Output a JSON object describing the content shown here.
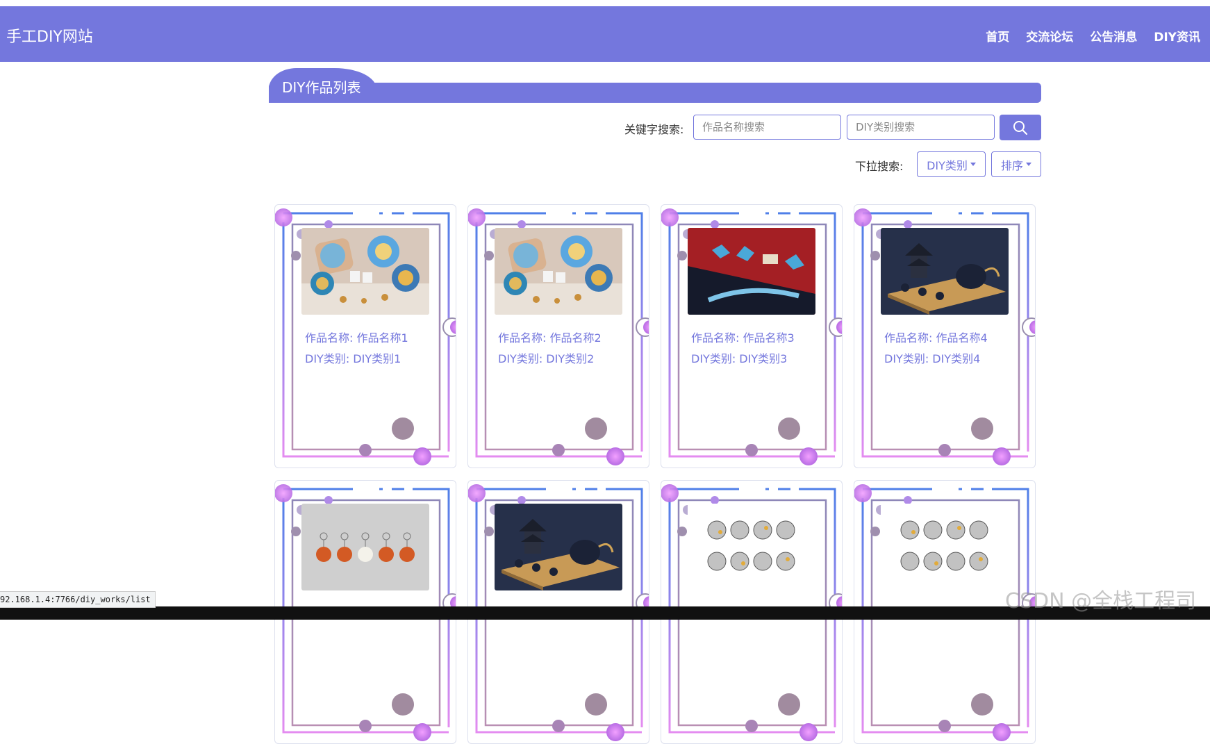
{
  "navbar": {
    "brand": "手工DIY网站",
    "links": [
      "首页",
      "交流论坛",
      "公告消息",
      "DIY资讯"
    ]
  },
  "section": {
    "title": "DIY作品列表"
  },
  "search": {
    "label": "关键字搜索:",
    "name_placeholder": "作品名称搜索",
    "category_placeholder": "DIY类别搜索",
    "button_icon": "search-icon"
  },
  "dropdown": {
    "label": "下拉搜索:",
    "category_button": "DIY类别",
    "sort_button": "排序"
  },
  "cards": [
    {
      "name": "作品名称: 作品名称1",
      "category": "DIY类别: DIY类别1",
      "image": "pillows-plates-photo"
    },
    {
      "name": "作品名称: 作品名称2",
      "category": "DIY类别: DIY类别2",
      "image": "pillows-plates-photo"
    },
    {
      "name": "作品名称: 作品名称3",
      "category": "DIY类别: DIY类别3",
      "image": "blue-rings-photo"
    },
    {
      "name": "作品名称: 作品名称4",
      "category": "DIY类别: DIY类别4",
      "image": "pagoda-teaset-photo"
    },
    {
      "name": "",
      "category": "",
      "image": "keychains-photo"
    },
    {
      "name": "",
      "category": "",
      "image": "pagoda-teaset-photo"
    },
    {
      "name": "",
      "category": "",
      "image": "badges-photo"
    },
    {
      "name": "",
      "category": "",
      "image": "badges-photo"
    }
  ],
  "status_url": "92.168.1.4:7766/diy_works/list",
  "watermark": "CSDN @全栈工程司",
  "colors": {
    "primary": "#7477dd",
    "card_text": "#7477dd"
  }
}
